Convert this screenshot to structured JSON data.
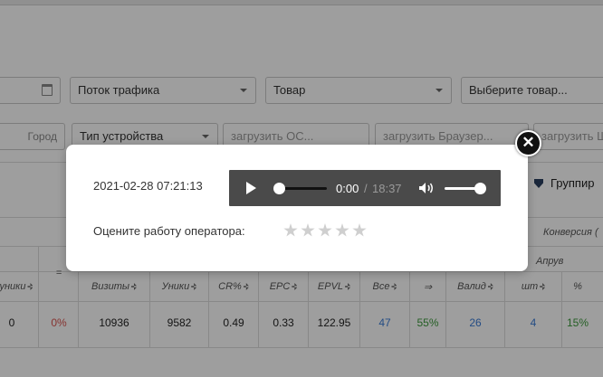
{
  "filters": {
    "row1": {
      "date_value": "",
      "traffic_stream": "Поток трафика",
      "product": "Товар",
      "product_select": "Выберите товар..."
    },
    "row2": {
      "city": "Город",
      "device_type": "Тип устройства",
      "os": "загрузить ОС...",
      "browser": "загрузить Браузер...",
      "last": "загрузить Ш"
    }
  },
  "toolbar": {
    "group_label": "Группир"
  },
  "table": {
    "group_headers": {
      "conversion": "Конверсия (",
      "approve": "Апрув"
    },
    "columns": {
      "uniq_left": "уники",
      "eq": "=",
      "visits": "Визиты",
      "uniques": "Уники",
      "cr": "CR%",
      "epc": "EPC",
      "epvl": "EPVL",
      "all": "Все",
      "arrow": "⇒",
      "valid": "Валид",
      "pcs": "шт",
      "pct": "%"
    },
    "row": {
      "uniq_left": "0",
      "eq": "0%",
      "visits": "10936",
      "uniques": "9582",
      "cr": "0.49",
      "epc": "0.33",
      "epvl": "122.95",
      "all": "47",
      "arrow": "55%",
      "valid": "26",
      "pcs": "4",
      "pct": "15%"
    }
  },
  "modal": {
    "datetime": "2021-02-28 07:21:13",
    "player": {
      "current_time": "0:00",
      "separator": "/",
      "total_time": "18:37",
      "progress": 0,
      "volume": 1.0,
      "play_icon": "play-icon",
      "volume_icon": "volume-icon"
    },
    "rate_label": "Оцените работу оператора:",
    "rating": {
      "max": 5,
      "value": 0
    },
    "close_icon": "close-icon"
  },
  "colors": {
    "overlay": "#000000",
    "player_bg": "#4a4a4a",
    "red": "#d9534f",
    "blue": "#3a7bd5",
    "green": "#3c9a3c"
  }
}
